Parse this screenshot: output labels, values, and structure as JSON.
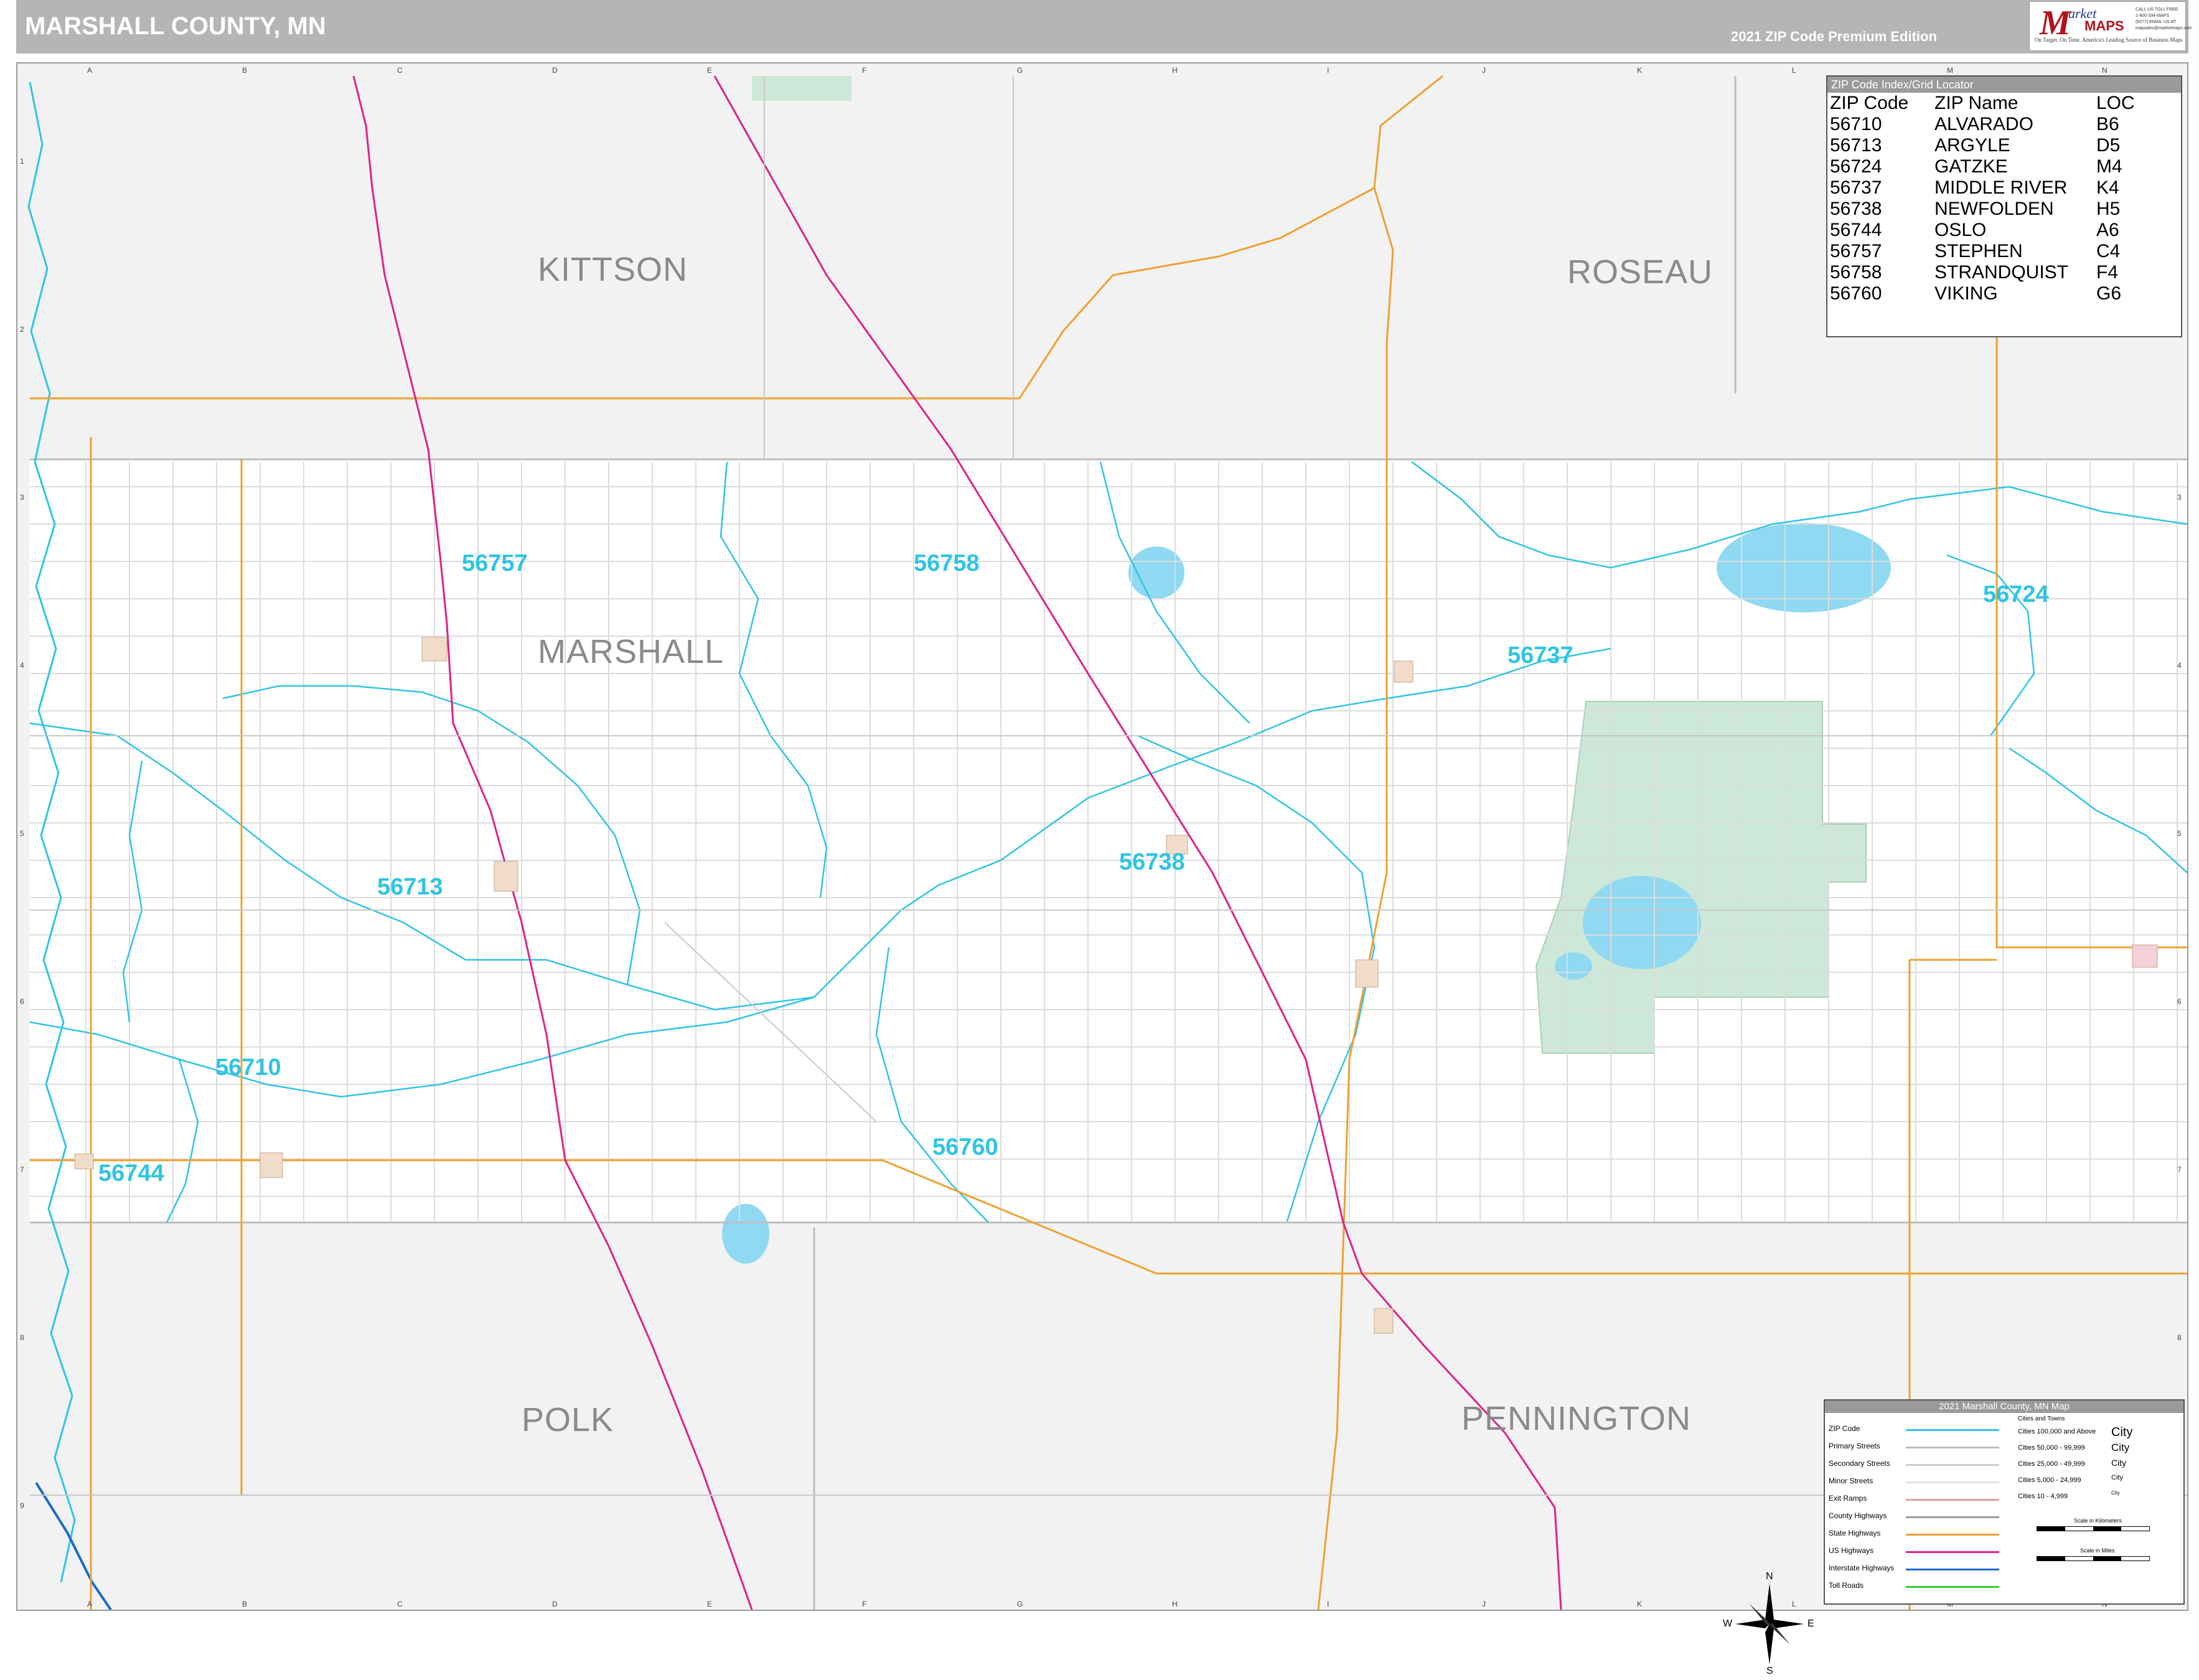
{
  "header": {
    "title": "MARSHALL COUNTY, MN",
    "edition": "2021 ZIP Code Premium Edition",
    "logo": {
      "letter": "M",
      "market": "arket",
      "maps": "MAPS",
      "tagline": "On Target. On Time.  America's Leading Source of Business Maps",
      "contact": "CALL US TOLL FREE 1-800-334-MAPS (6277)  EMAIL US AT: mapsales@marketmaps.com"
    }
  },
  "grid": {
    "columns": [
      "A",
      "B",
      "C",
      "D",
      "E",
      "F",
      "G",
      "H",
      "I",
      "J",
      "K",
      "L",
      "M",
      "N"
    ],
    "rows": [
      "1",
      "2",
      "3",
      "4",
      "5",
      "6",
      "7",
      "8",
      "9"
    ]
  },
  "counties": {
    "kittson": "KITTSON",
    "roseau": "ROSEAU",
    "marshall": "MARSHALL",
    "polk": "POLK",
    "pennington": "PENNINGTON"
  },
  "zip_labels": {
    "z56757": "56757",
    "z56758": "56758",
    "z56724": "56724",
    "z56737": "56737",
    "z56713": "56713",
    "z56738": "56738",
    "z56710": "56710",
    "z56760": "56760",
    "z56744": "56744"
  },
  "zip_index": {
    "title": "ZIP Code Index/Grid Locator",
    "headers": [
      "ZIP Code",
      "ZIP Name",
      "LOC"
    ],
    "rows": [
      [
        "56710",
        "ALVARADO",
        "B6"
      ],
      [
        "56713",
        "ARGYLE",
        "D5"
      ],
      [
        "56724",
        "GATZKE",
        "M4"
      ],
      [
        "56737",
        "MIDDLE RIVER",
        "K4"
      ],
      [
        "56738",
        "NEWFOLDEN",
        "H5"
      ],
      [
        "56744",
        "OSLO",
        "A6"
      ],
      [
        "56757",
        "STEPHEN",
        "C4"
      ],
      [
        "56758",
        "STRANDQUIST",
        "F4"
      ],
      [
        "56760",
        "VIKING",
        "G6"
      ]
    ]
  },
  "legend": {
    "title": "2021 Marshall County, MN Map",
    "items": [
      {
        "label": "ZIP Code",
        "color": "#2fc4e4"
      },
      {
        "label": "Primary Streets",
        "color": "#bdbdbd"
      },
      {
        "label": "Secondary Streets",
        "color": "#cfcfcf"
      },
      {
        "label": "Minor Streets",
        "color": "#e2e2e2"
      },
      {
        "label": "Exit Ramps",
        "color": "#e0a0a0"
      },
      {
        "label": "County Highways",
        "color": "#9a9a9a"
      },
      {
        "label": "State Highways",
        "color": "#f0a030"
      },
      {
        "label": "US Highways",
        "color": "#e0208a"
      },
      {
        "label": "Interstate Highways",
        "color": "#1a6acb"
      },
      {
        "label": "Toll Roads",
        "color": "#33cc33"
      }
    ],
    "cities_header": "Cities and Towns",
    "cities": [
      {
        "label": "Cities 100,000 and Above",
        "mark": "City"
      },
      {
        "label": "Cities 50,000 - 99,999",
        "mark": "City"
      },
      {
        "label": "Cities 25,000 - 49,999",
        "mark": "City"
      },
      {
        "label": "Cities 5,000 - 24,999",
        "mark": "City"
      },
      {
        "label": "Cities 10 - 4,999",
        "mark": "City"
      }
    ],
    "scale_km": "Scale in Kilometers",
    "scale_mi": "Scale in Miles"
  },
  "compass": {
    "n": "N",
    "s": "S",
    "e": "E",
    "w": "W"
  },
  "colors": {
    "zip_boundary": "#2fc4e4",
    "us_highway": "#e0208a",
    "state_highway": "#f0a030",
    "water": "#8fd9f2",
    "refuge": "#cde8d8",
    "outside_county": "#f2f2f2"
  }
}
